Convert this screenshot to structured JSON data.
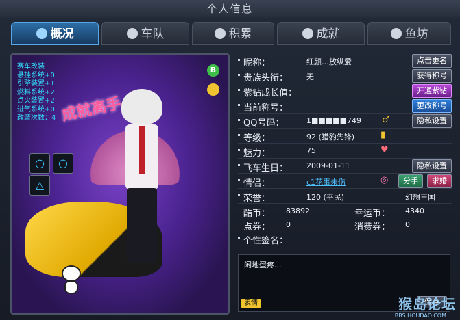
{
  "window": {
    "title": "个人信息"
  },
  "tabs": [
    {
      "label": "概况",
      "icon": "target-icon",
      "active": true
    },
    {
      "label": "车队",
      "icon": "star-icon"
    },
    {
      "label": "积累",
      "icon": "gear-icon"
    },
    {
      "label": "成就",
      "icon": "medal-icon"
    },
    {
      "label": "鱼坊",
      "icon": "bowl-icon"
    }
  ],
  "avatar_panel": {
    "stats": [
      "赛车改装",
      "悬挂系统+0",
      "引擎装置+1",
      "燃料系统+2",
      "点火装置+2",
      "进气系统+0",
      "改装次数：4"
    ],
    "achievement_banner": "成就高手",
    "badge_b": "B",
    "slot_symbols": [
      "○",
      "○",
      "△"
    ]
  },
  "profile": {
    "nickname_label": "昵称：",
    "nickname_value": "红颜…放纵爱",
    "rename_button": "点击更名",
    "noble_title_label": "贵族头衔：",
    "noble_title_value": "无",
    "get_title_button": "获得称号",
    "purple_diamond_label": "紫钻成长值：",
    "open_purple_button": "开通紫钻",
    "current_title_label": "当前称号：",
    "change_title_button": "更改称号",
    "qq_label": "QQ号码：",
    "qq_value": "1■■■■■749",
    "privacy_button_1": "隐私设置",
    "level_label": "等级：",
    "level_value": "92 (猎豹先锋)",
    "charm_label": "魅力：",
    "charm_value": "75",
    "birthday_label": "飞车生日：",
    "birthday_value": "2009-01-11",
    "privacy_button_2": "隐私设置",
    "partner_label": "情侣：",
    "partner_value": "c1花事未伤",
    "breakup_button": "分手",
    "propose_button": "求婚",
    "honor_label": "荣誉：",
    "honor_value": "120 (平民)",
    "honor_realm": "幻想王国",
    "cool_coin_label": "酷币：",
    "cool_coin_value": "83892",
    "lucky_coin_label": "幸运币：",
    "lucky_coin_value": "4340",
    "voucher_label": "点券：",
    "voucher_value": "0",
    "spend_label": "消费券：",
    "spend_value": "0",
    "signature_label": "个性签名：",
    "signature_value": "闲地蛋疼...",
    "emote_button": "表情",
    "save_button": "保存"
  },
  "watermark": {
    "text": "猴岛论坛",
    "url": "BBS.HOUDAO.COM"
  },
  "colors": {
    "accent": "#2f7fd8",
    "stats_text": "#33e0ff",
    "purple_btn": "#b94ad8"
  }
}
